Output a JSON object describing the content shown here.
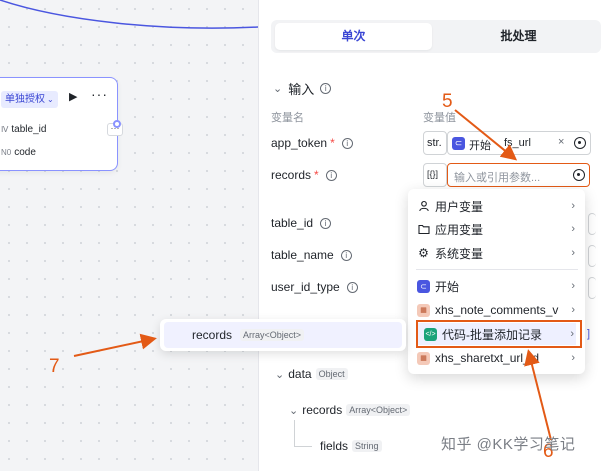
{
  "node": {
    "badge_label": "单独授权",
    "fields": [
      {
        "tag": "Ⅳ",
        "name": "table_id"
      },
      {
        "tag": "N0",
        "name": "code"
      }
    ],
    "more_label": "···"
  },
  "tabs": [
    {
      "label": "单次",
      "active": true
    },
    {
      "label": "批处理",
      "active": false
    }
  ],
  "section": {
    "title": "输入"
  },
  "columns": {
    "var_name": "变量名",
    "var_value": "变量值"
  },
  "fields": [
    {
      "label": "app_token",
      "required": true,
      "type_tag": "str.",
      "value_prefix": "开始",
      "value": "fs_url"
    },
    {
      "label": "records",
      "required": true,
      "type_tag": "[{}]",
      "placeholder": "输入或引用参数..."
    },
    {
      "label": "table_id",
      "required": false
    },
    {
      "label": "table_name",
      "required": false
    },
    {
      "label": "user_id_type",
      "required": false
    }
  ],
  "dropdown": {
    "items": [
      {
        "label": "用户变量",
        "icon": "user-icon"
      },
      {
        "label": "应用变量",
        "icon": "folder-icon"
      },
      {
        "label": "系统变量",
        "icon": "gear-icon"
      },
      {
        "label": "开始",
        "icon": "start-node-icon"
      },
      {
        "label": "xhs_note_comments_v",
        "icon": "plugin-icon"
      },
      {
        "label": "代码-批量添加记录",
        "icon": "code-icon",
        "highlighted": true
      },
      {
        "label": "xhs_sharetxt_url_id",
        "icon": "plugin-icon"
      }
    ]
  },
  "sub_popup": {
    "label": "records",
    "type": "Array<Object>"
  },
  "tree": [
    {
      "label": "data",
      "type": "Object"
    },
    {
      "label": "records",
      "type": "Array<Object>"
    },
    {
      "label": "fields",
      "type": "String"
    }
  ],
  "annotations": {
    "a5": "5",
    "a6": "6",
    "a7": "7"
  },
  "watermark": "知乎 @KK学习笔记",
  "colors": {
    "accent": "#3b47d4",
    "annotation": "#e35a16",
    "node_border": "#8a93ff"
  }
}
